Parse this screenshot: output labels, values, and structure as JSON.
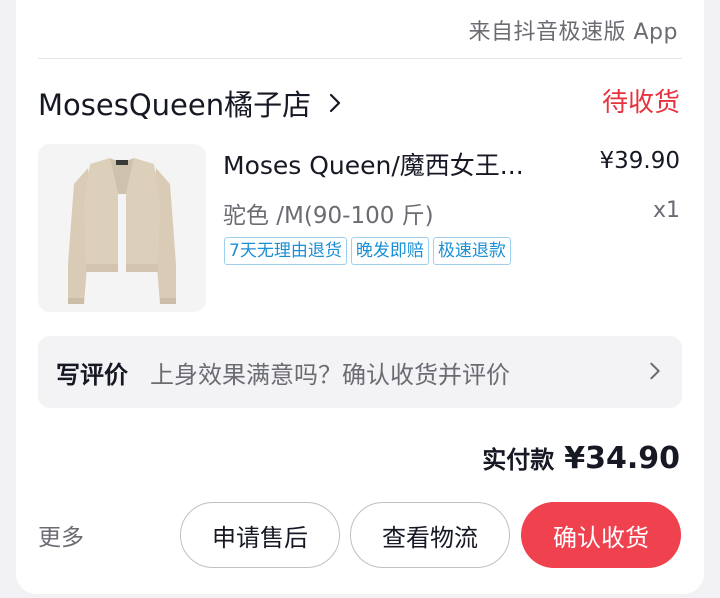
{
  "header": {
    "source": "来自抖音极速版 App"
  },
  "shop": {
    "name": "MosesQueen橘子店",
    "status": "待收货"
  },
  "product": {
    "title": "Moses Queen/魔西女王...",
    "price": "¥39.90",
    "spec": "驼色 /M(90-100 斤)",
    "quantity": "x1",
    "tags": [
      "7天无理由退货",
      "晚发即赔",
      "极速退款"
    ]
  },
  "review": {
    "title": "写评价",
    "hint": "上身效果满意吗？确认收货并评价"
  },
  "payment": {
    "label": "实付款",
    "amount": "¥34.90"
  },
  "actions": {
    "more": "更多",
    "after_sale": "申请售后",
    "logistics": "查看物流",
    "confirm": "确认收货"
  },
  "colors": {
    "accent": "#f0414f",
    "status": "#e8323e",
    "tag": "#1a8fd6"
  }
}
